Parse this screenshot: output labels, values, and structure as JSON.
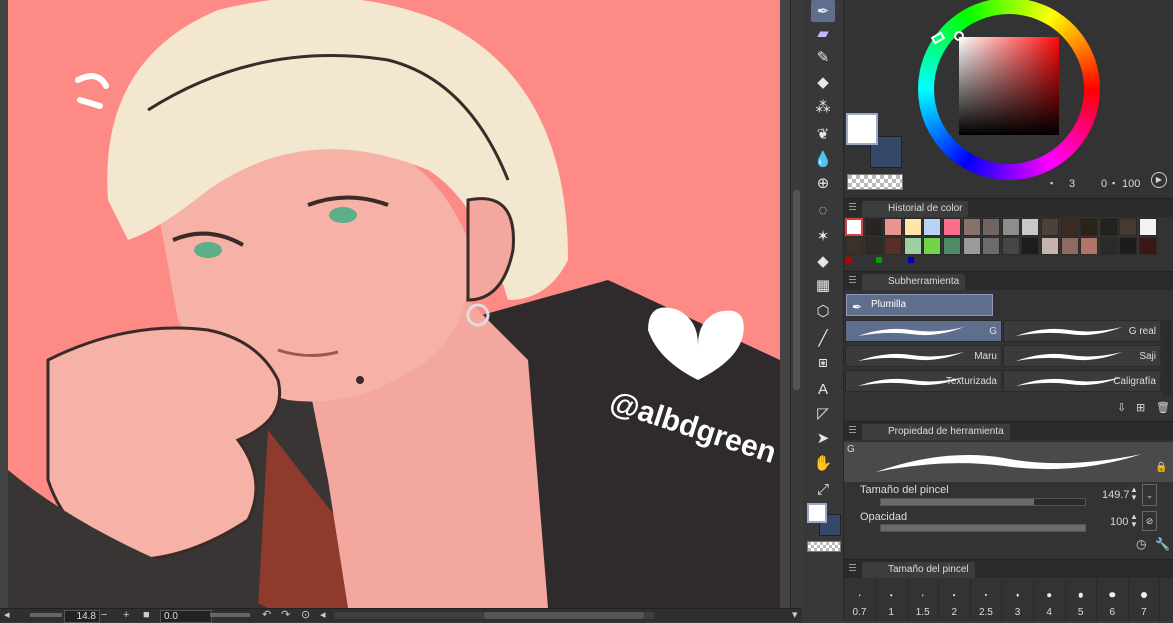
{
  "canvas": {
    "watermark": "@albdgreen",
    "background": "#fe8a86"
  },
  "bottombar": {
    "zoom": "14.8",
    "angle": "0.0"
  },
  "tools": [
    "pen-icon",
    "marker-icon",
    "pencil-icon",
    "eraser-icon",
    "airbrush-icon",
    "decoration-icon",
    "blend-icon",
    "transform-icon",
    "lasso-icon",
    "magic-wand-icon",
    "fill-icon",
    "gradient-icon",
    "3d-object-icon",
    "line-icon",
    "frame-icon",
    "text-icon",
    "vector-icon",
    "object-select-icon",
    "hand-icon",
    "eyedropper-icon"
  ],
  "color": {
    "main": "#ffffff",
    "sub": "#34486a",
    "h": "3",
    "s": "0",
    "v": "100"
  },
  "history": {
    "title": "Historial de color",
    "colors": [
      "#ffffff",
      "#2c2220",
      "#e99490",
      "#ffe6a8",
      "#b9d3f5",
      "#fc6e8c",
      "#877268",
      "#6f6663",
      "#8f8c8c",
      "#c9c9c9",
      "#4c4239",
      "#3d2a22",
      "#2a2418",
      "#22221c",
      "#433b31",
      "#f2f2f2",
      "#3c3128",
      "#2d2a27",
      "#5a2e27",
      "#9dcfa0",
      "#70d548",
      "#4e8a66",
      "#9a9a9a",
      "#6a6b6c",
      "#464646",
      "#1d1d1d",
      "#c7b3ad",
      "#8e6b62",
      "#b07468",
      "#2a2a2a",
      "#1c1c1c",
      "#3b1616"
    ]
  },
  "subtool": {
    "title": "Subherramienta",
    "group": "Plumilla",
    "brushes": [
      {
        "name": "G",
        "selected": true
      },
      {
        "name": "G real",
        "selected": false
      },
      {
        "name": "Maru",
        "selected": false
      },
      {
        "name": "Saji",
        "selected": false
      },
      {
        "name": "Texturizada",
        "selected": false
      },
      {
        "name": "Caligrafía",
        "selected": false
      }
    ]
  },
  "toolprop": {
    "title": "Propiedad de herramienta",
    "preset_label": "G",
    "brush_size_label": "Tamaño del pincel",
    "brush_size_value": "149.7",
    "brush_size_fraction": 0.75,
    "opacity_label": "Opacidad",
    "opacity_value": "100",
    "opacity_fraction": 1.0
  },
  "brushsize": {
    "title": "Tamaño del pincel",
    "sizes": [
      "0.7",
      "1",
      "1.5",
      "2",
      "2.5",
      "3",
      "4",
      "5",
      "6",
      "7"
    ]
  }
}
